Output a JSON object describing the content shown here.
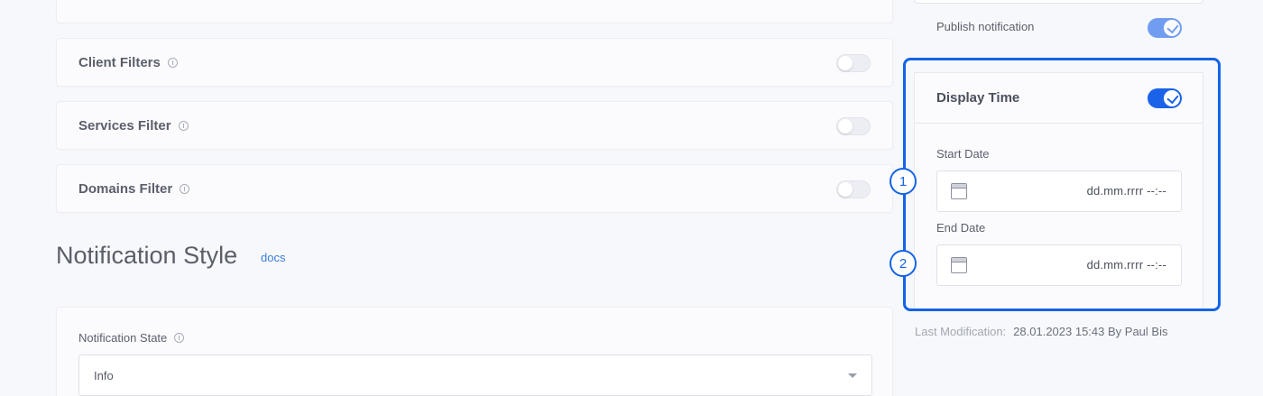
{
  "filters": [
    {
      "label": "Client Filters",
      "enabled": false
    },
    {
      "label": "Services Filter",
      "enabled": false
    },
    {
      "label": "Domains Filter",
      "enabled": false
    }
  ],
  "notification_style": {
    "title": "Notification Style",
    "docs_link": "docs",
    "state_label": "Notification State",
    "state_value": "Info"
  },
  "sidebar": {
    "publish_label": "Publish notification",
    "publish_enabled": true,
    "display_time": {
      "title": "Display Time",
      "enabled": true,
      "start_label": "Start Date",
      "start_value": "dd.mm.rrrr  --:--",
      "end_label": "End Date",
      "end_value": "dd.mm.rrrr  --:--"
    },
    "last_modification_label": "Last Modification:",
    "last_modification_value": "28.01.2023 15:43 By Paul Bis"
  },
  "annotations": {
    "step1": "1",
    "step2": "2"
  },
  "colors": {
    "accent": "#1a62e8",
    "highlight": "#1464e6",
    "link": "#3b7ddd"
  },
  "icons": [
    "info-icon",
    "calendar-icon",
    "check-icon",
    "chevron-down-icon"
  ]
}
